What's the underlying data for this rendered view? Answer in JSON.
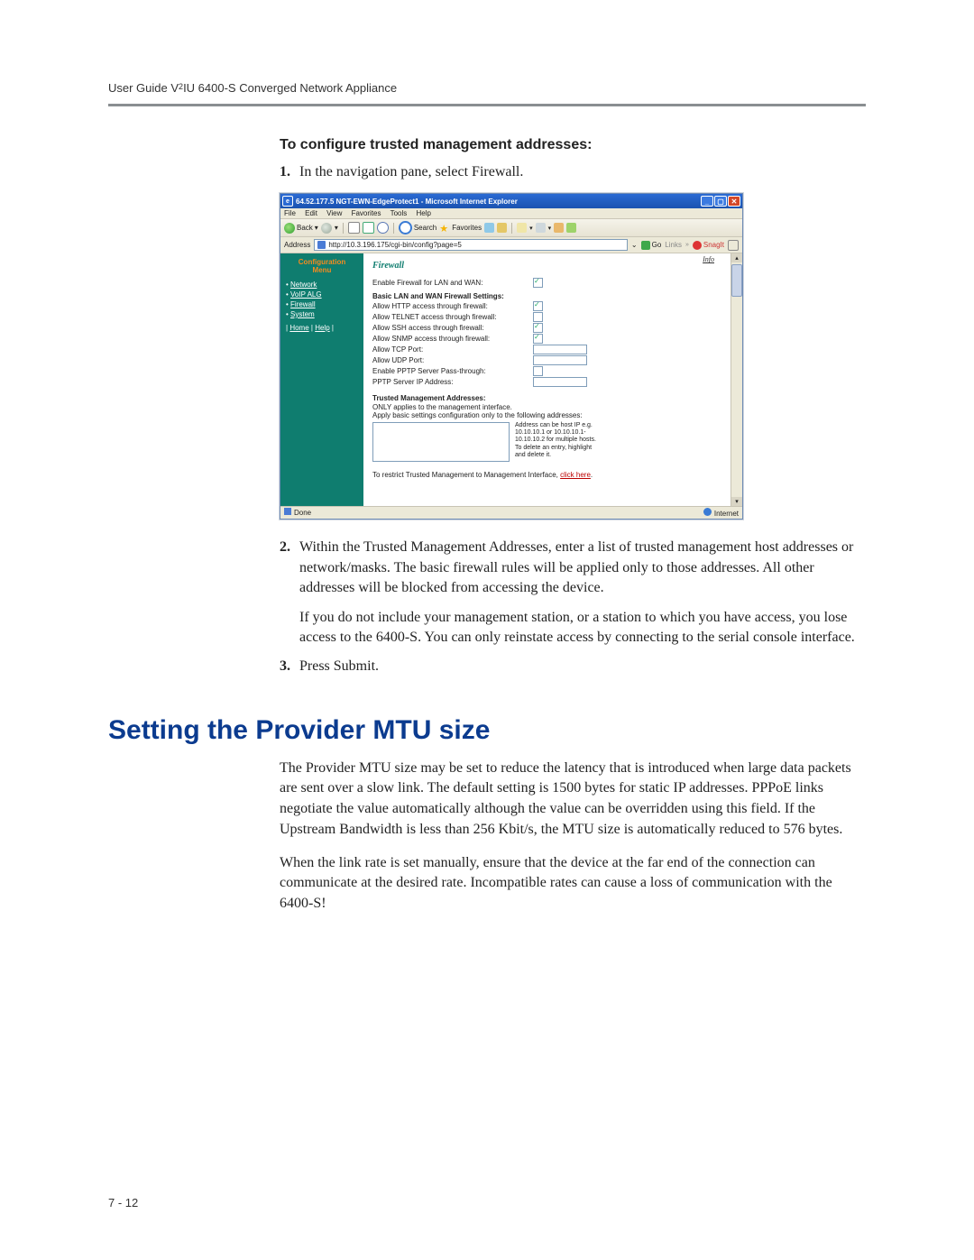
{
  "header": {
    "running_head_pre": "User Guide V",
    "running_head_sup": "2",
    "running_head_post": "IU 6400-S Converged Network Appliance"
  },
  "section1": {
    "subhead": "To configure trusted management addresses:",
    "step1_num": "1.",
    "step1_text": "In the navigation pane, select Firewall.",
    "step2_num": "2.",
    "step2_text": "Within the Trusted Management Addresses, enter a list of trusted management host addresses or network/masks. The basic firewall rules will be applied only to those addresses. All other addresses will be blocked from accessing the device.",
    "step2_extra": "If you do not include your management station, or a station to which you have access, you lose access to the 6400-S. You can only reinstate access by connecting to the serial console interface.",
    "step3_num": "3.",
    "step3_text": "Press Submit."
  },
  "section2": {
    "title": "Setting the Provider MTU size",
    "para1": "The Provider MTU size may be set to reduce the latency that is introduced when large data packets are sent over a slow link. The default setting is 1500 bytes for static IP addresses. PPPoE links negotiate the value automatically although the value can be overridden using this field. If the Upstream Bandwidth is less than 256 Kbit/s, the MTU size is automatically reduced to 576 bytes.",
    "para2": "When the link rate is set manually, ensure that the device at the far end of the connection can communicate at the desired rate. Incompatible rates can cause a loss of communication with the 6400-S!"
  },
  "screenshot": {
    "titlebar": "64.52.177.5 NGT-EWN-EdgeProtect1 - Microsoft Internet Explorer",
    "menubar": {
      "file": "File",
      "edit": "Edit",
      "view": "View",
      "favorites": "Favorites",
      "tools": "Tools",
      "help": "Help"
    },
    "toolbar": {
      "back": "Back",
      "search": "Search",
      "favorites": "Favorites"
    },
    "addressbar": {
      "label": "Address",
      "url": "http://10.3.196.175/cgi-bin/config?page=5",
      "go": "Go",
      "links": "Links",
      "snagit": "SnagIt"
    },
    "sidebar": {
      "title1": "Configuration",
      "title2": "Menu",
      "items": [
        "Network",
        "VoIP ALG",
        "Firewall",
        "System"
      ],
      "home": "Home",
      "help": "Help"
    },
    "panel": {
      "info": "Info",
      "title": "Firewall",
      "enable_label": "Enable Firewall for LAN and WAN:",
      "basic_section": "Basic LAN and WAN Firewall Settings:",
      "rows": {
        "http": "Allow HTTP access through firewall:",
        "telnet": "Allow TELNET access through firewall:",
        "ssh": "Allow SSH access through firewall:",
        "snmp": "Allow SNMP access through firewall:",
        "tcp": "Allow TCP Port:",
        "udp": "Allow UDP Port:",
        "pptp": "Enable PPTP Server Pass-through:",
        "pptp_ip": "PPTP Server IP Address:"
      },
      "trusted_section": "Trusted Management Addresses:",
      "trusted_note1": "ONLY applies to the management interface.",
      "trusted_note2": "Apply basic settings configuration only to the following addresses:",
      "hint": "Address can be host IP e.g. 10.10.10.1 or 10.10.10.1-10.10.10.2 for multiple hosts. To delete an entry, highlight and delete it.",
      "restrict_pre": "To restrict Trusted Management to Management Interface, ",
      "restrict_link": "click here",
      "restrict_post": "."
    },
    "statusbar": {
      "done": "Done",
      "zone": "Internet"
    }
  },
  "footer": {
    "page_num": "7 - 12"
  }
}
